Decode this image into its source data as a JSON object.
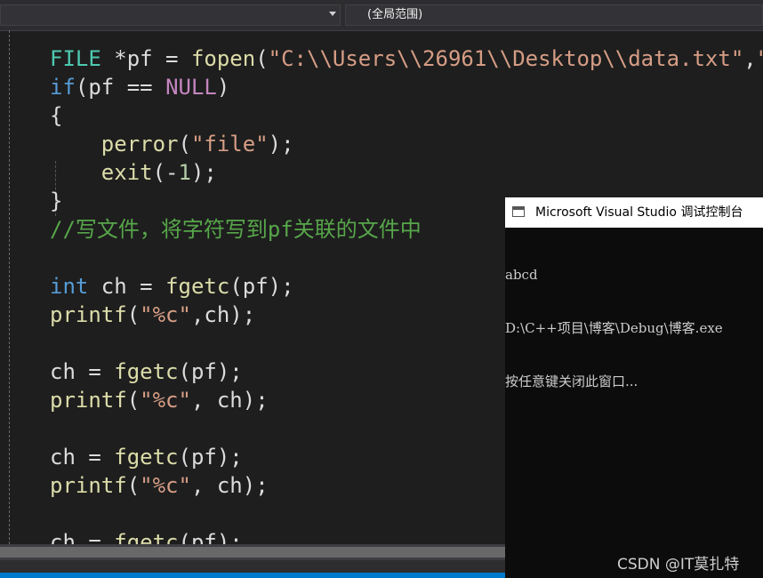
{
  "toolbar": {
    "scope_selector_value": "",
    "scope_label": "(全局范围)"
  },
  "colors": {
    "editor_background": "#1e1e1e",
    "keyword": "#569cd6",
    "function": "#dcdcaa",
    "string": "#d69d85",
    "comment": "#57a64a",
    "macro": "#c586c0",
    "console_background": "#0c0c0c"
  },
  "editor": {
    "lines": [
      [
        [
          "FILE",
          "#4ec9b0"
        ],
        [
          " *pf = ",
          "#dcdcdc"
        ],
        [
          "fopen",
          "#dcdcaa"
        ],
        [
          "(",
          "#dcdcdc"
        ],
        [
          "\"C:\\\\Users\\\\26961\\\\Desktop\\\\data.txt\"",
          "#d69d85"
        ],
        [
          ",",
          "#dcdcdc"
        ],
        [
          "\"r\"",
          "#d69d85"
        ],
        [
          ");",
          "#dcdcdc"
        ]
      ],
      [
        [
          "if",
          "#569cd6"
        ],
        [
          "(pf == ",
          "#dcdcdc"
        ],
        [
          "NULL",
          "#c586c0"
        ],
        [
          ")",
          "#dcdcdc"
        ]
      ],
      [
        [
          "{",
          "#dcdcdc"
        ]
      ],
      [
        [
          "    ",
          "#dcdcdc"
        ],
        [
          "perror",
          "#dcdcaa"
        ],
        [
          "(",
          "#dcdcdc"
        ],
        [
          "\"file\"",
          "#d69d85"
        ],
        [
          ");",
          "#dcdcdc"
        ]
      ],
      [
        [
          "    ",
          "#dcdcdc"
        ],
        [
          "exit",
          "#dcdcaa"
        ],
        [
          "(-",
          "#dcdcdc"
        ],
        [
          "1",
          "#b5cea8"
        ],
        [
          ");",
          "#dcdcdc"
        ]
      ],
      [
        [
          "}",
          "#dcdcdc"
        ]
      ],
      [
        [
          "//写文件，将字符写到pf关联的文件中",
          "#57a64a"
        ]
      ],
      [],
      [
        [
          "int",
          "#569cd6"
        ],
        [
          " ch = ",
          "#dcdcdc"
        ],
        [
          "fgetc",
          "#dcdcaa"
        ],
        [
          "(pf);",
          "#dcdcdc"
        ]
      ],
      [
        [
          "printf",
          "#dcdcaa"
        ],
        [
          "(",
          "#dcdcdc"
        ],
        [
          "\"%c\"",
          "#d69d85"
        ],
        [
          ",ch);",
          "#dcdcdc"
        ]
      ],
      [],
      [
        [
          "ch = ",
          "#dcdcdc"
        ],
        [
          "fgetc",
          "#dcdcaa"
        ],
        [
          "(pf);",
          "#dcdcdc"
        ]
      ],
      [
        [
          "printf",
          "#dcdcaa"
        ],
        [
          "(",
          "#dcdcdc"
        ],
        [
          "\"%c\"",
          "#d69d85"
        ],
        [
          ", ch);",
          "#dcdcdc"
        ]
      ],
      [],
      [
        [
          "ch = ",
          "#dcdcdc"
        ],
        [
          "fgetc",
          "#dcdcaa"
        ],
        [
          "(pf);",
          "#dcdcdc"
        ]
      ],
      [
        [
          "printf",
          "#dcdcaa"
        ],
        [
          "(",
          "#dcdcdc"
        ],
        [
          "\"%c\"",
          "#d69d85"
        ],
        [
          ", ch);",
          "#dcdcdc"
        ]
      ],
      [],
      [
        [
          "ch = ",
          "#dcdcdc"
        ],
        [
          "fgetc",
          "#dcdcaa"
        ],
        [
          "(pf);",
          "#dcdcdc"
        ]
      ]
    ]
  },
  "console": {
    "title": "Microsoft Visual Studio 调试控制台",
    "icon": "console-window-icon",
    "output_lines": [
      "abcd",
      "D:\\C++项目\\博客\\Debug\\博客.exe",
      "按任意键关闭此窗口..."
    ]
  },
  "watermark": "CSDN @IT莫扎特"
}
